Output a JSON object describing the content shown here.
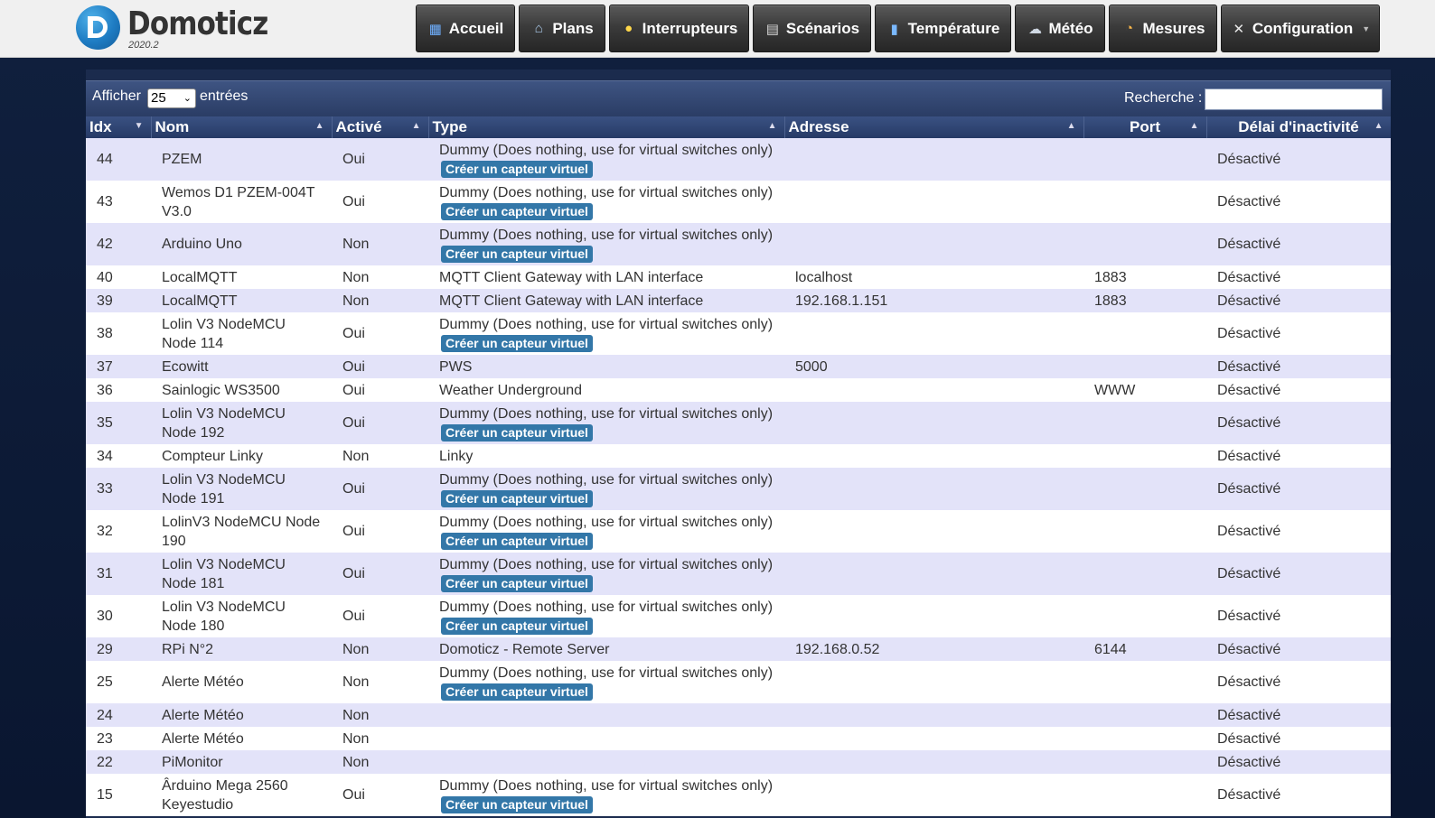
{
  "app": {
    "name": "Domoticz",
    "version": "2020.2"
  },
  "nav": [
    {
      "label": "Accueil",
      "icon": "home-icon"
    },
    {
      "label": "Plans",
      "icon": "plans-icon"
    },
    {
      "label": "Interrupteurs",
      "icon": "bulb-icon"
    },
    {
      "label": "Scénarios",
      "icon": "scenario-icon"
    },
    {
      "label": "Température",
      "icon": "thermometer-icon"
    },
    {
      "label": "Météo",
      "icon": "weather-icon"
    },
    {
      "label": "Mesures",
      "icon": "gauge-icon"
    },
    {
      "label": "Configuration",
      "icon": "tools-icon"
    }
  ],
  "toolbar": {
    "show_label": "Afficher",
    "page_length": "25",
    "entries_label": "entrées",
    "search_label": "Recherche :",
    "search_value": ""
  },
  "table": {
    "columns": [
      "Idx",
      "Nom",
      "Activé",
      "Type",
      "Adresse",
      "Port",
      "Délai d'inactivité"
    ],
    "create_virtual_label": "Créer un capteur virtuel",
    "rows": [
      {
        "idx": "44",
        "name": "PZEM",
        "enabled": "Oui",
        "type": "Dummy (Does nothing, use for virtual switches only)",
        "address": "",
        "port": "",
        "timeout": "Désactivé",
        "virtual": true
      },
      {
        "idx": "43",
        "name": "Wemos D1 PZEM-004T V3.0",
        "enabled": "Oui",
        "type": "Dummy (Does nothing, use for virtual switches only)",
        "address": "",
        "port": "",
        "timeout": "Désactivé",
        "virtual": true
      },
      {
        "idx": "42",
        "name": "Arduino Uno",
        "enabled": "Non",
        "type": "Dummy (Does nothing, use for virtual switches only)",
        "address": "",
        "port": "",
        "timeout": "Désactivé",
        "virtual": true
      },
      {
        "idx": "40",
        "name": "LocalMQTT",
        "enabled": "Non",
        "type": "MQTT Client Gateway with LAN interface",
        "address": "localhost",
        "port": "1883",
        "timeout": "Désactivé",
        "virtual": false
      },
      {
        "idx": "39",
        "name": "LocalMQTT",
        "enabled": "Non",
        "type": "MQTT Client Gateway with LAN interface",
        "address": "192.168.1.151",
        "port": "1883",
        "timeout": "Désactivé",
        "virtual": false
      },
      {
        "idx": "38",
        "name": "Lolin V3 NodeMCU Node 114",
        "enabled": "Oui",
        "type": "Dummy (Does nothing, use for virtual switches only)",
        "address": "",
        "port": "",
        "timeout": "Désactivé",
        "virtual": true
      },
      {
        "idx": "37",
        "name": "Ecowitt",
        "enabled": "Oui",
        "type": "PWS",
        "address": "5000",
        "port": "",
        "timeout": "Désactivé",
        "virtual": false
      },
      {
        "idx": "36",
        "name": "Sainlogic WS3500",
        "enabled": "Oui",
        "type": "Weather Underground",
        "address": "",
        "port": "WWW",
        "timeout": "Désactivé",
        "virtual": false
      },
      {
        "idx": "35",
        "name": "Lolin V3 NodeMCU Node 192",
        "enabled": "Oui",
        "type": "Dummy (Does nothing, use for virtual switches only)",
        "address": "",
        "port": "",
        "timeout": "Désactivé",
        "virtual": true
      },
      {
        "idx": "34",
        "name": "Compteur Linky",
        "enabled": "Non",
        "type": "Linky",
        "address": "",
        "port": "",
        "timeout": "Désactivé",
        "virtual": false
      },
      {
        "idx": "33",
        "name": "Lolin V3 NodeMCU Node 191",
        "enabled": "Oui",
        "type": "Dummy (Does nothing, use for virtual switches only)",
        "address": "",
        "port": "",
        "timeout": "Désactivé",
        "virtual": true
      },
      {
        "idx": "32",
        "name": "LolinV3 NodeMCU Node 190",
        "enabled": "Oui",
        "type": "Dummy (Does nothing, use for virtual switches only)",
        "address": "",
        "port": "",
        "timeout": "Désactivé",
        "virtual": true
      },
      {
        "idx": "31",
        "name": "Lolin V3 NodeMCU Node 181",
        "enabled": "Oui",
        "type": "Dummy (Does nothing, use for virtual switches only)",
        "address": "",
        "port": "",
        "timeout": "Désactivé",
        "virtual": true
      },
      {
        "idx": "30",
        "name": "Lolin V3 NodeMCU Node 180",
        "enabled": "Oui",
        "type": "Dummy (Does nothing, use for virtual switches only)",
        "address": "",
        "port": "",
        "timeout": "Désactivé",
        "virtual": true
      },
      {
        "idx": "29",
        "name": "RPi N°2",
        "enabled": "Non",
        "type": "Domoticz - Remote Server",
        "address": "192.168.0.52",
        "port": "6144",
        "timeout": "Désactivé",
        "virtual": false
      },
      {
        "idx": "25",
        "name": "Alerte Météo",
        "enabled": "Non",
        "type": "Dummy (Does nothing, use for virtual switches only)",
        "address": "",
        "port": "",
        "timeout": "Désactivé",
        "virtual": true
      },
      {
        "idx": "24",
        "name": "Alerte Météo",
        "enabled": "Non",
        "type": "",
        "address": "",
        "port": "",
        "timeout": "Désactivé",
        "virtual": false
      },
      {
        "idx": "23",
        "name": "Alerte Météo",
        "enabled": "Non",
        "type": "",
        "address": "",
        "port": "",
        "timeout": "Désactivé",
        "virtual": false
      },
      {
        "idx": "22",
        "name": "PiMonitor",
        "enabled": "Non",
        "type": "",
        "address": "",
        "port": "",
        "timeout": "Désactivé",
        "virtual": false
      },
      {
        "idx": "15",
        "name": "Ârduino Mega 2560 Keyestudio",
        "enabled": "Oui",
        "type": "Dummy (Does nothing, use for virtual switches only)",
        "address": "",
        "port": "",
        "timeout": "Désactivé",
        "virtual": true
      }
    ]
  }
}
